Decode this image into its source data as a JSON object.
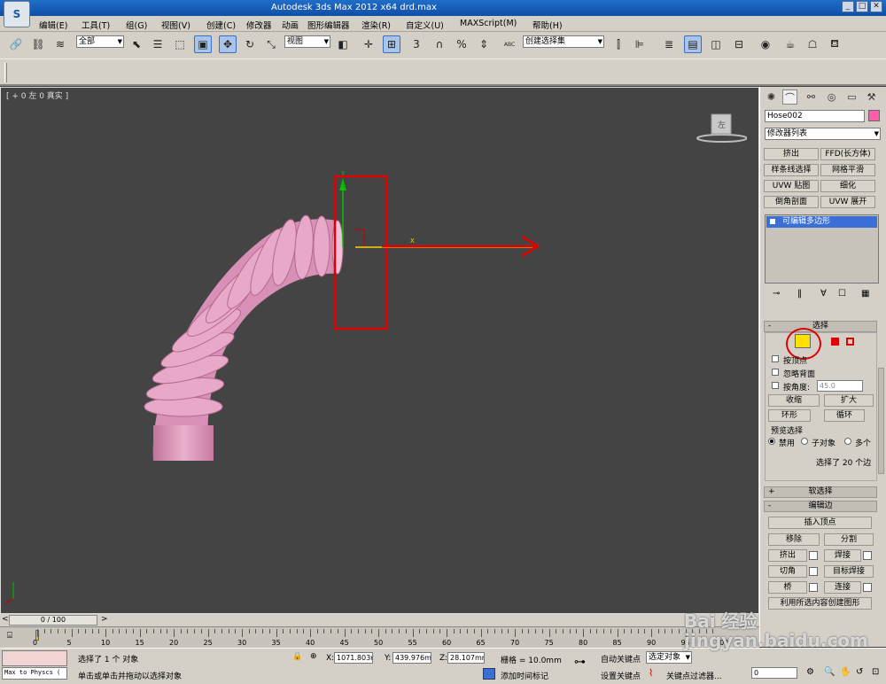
{
  "window": {
    "title": "Autodesk 3ds Max  2012 x64     drd.max",
    "logo": "S"
  },
  "menu": [
    "编辑(E)",
    "工具(T)",
    "组(G)",
    "视图(V)",
    "创建(C)",
    "修改器",
    "动画",
    "图形编辑器",
    "渲染(R)",
    "自定义(U)",
    "MAXScript(M)",
    "帮助(H)"
  ],
  "toolbar": {
    "selection_filter": "全部",
    "ref_coord": "视图",
    "named_selection": "创建选择集",
    "snap_3": "3",
    "percent": "%",
    "abc": "ABC"
  },
  "viewport": {
    "label": "[ + 0 左 0 真实 ]",
    "viewcube_face": "左",
    "axis_y": "Y",
    "axis_x": "X",
    "background": "#444444",
    "object_color": "#e6a0c4"
  },
  "panel": {
    "object_name": "Hose002",
    "object_color": "#ff5cab",
    "modifier_list": "修改器列表",
    "modifier_buttons": [
      "挤出",
      "FFD(长方体)",
      "样条线选择",
      "网格平滑",
      "UVW 贴图",
      "细化",
      "倒角剖面",
      "UVW 展开"
    ],
    "stack_item": "可编辑多边形",
    "selection": {
      "header": "选择",
      "by_vertex": "按顶点",
      "ignore_backfacing": "忽略背面",
      "by_angle": "按角度:",
      "angle_value": "45.0",
      "shrink": "收缩",
      "grow": "扩大",
      "ring": "环形",
      "loop": "循环",
      "preview_label": "预览选择",
      "disabled": "禁用",
      "sub_object": "子对象",
      "multi": "多个",
      "status": "选择了 20 个边"
    },
    "soft_selection": "软选择",
    "edit_edges": {
      "header": "编辑边",
      "insert_vertex": "插入顶点",
      "remove": "移除",
      "split": "分割",
      "extrude": "挤出",
      "weld": "焊接",
      "chamfer": "切角",
      "target_weld": "目标焊接",
      "bridge": "桥",
      "connect": "连接",
      "create_shape": "利用所选内容创建图形"
    }
  },
  "time": {
    "slider": "0 / 100",
    "ticks": [
      "0",
      "5",
      "10",
      "15",
      "20",
      "25",
      "30",
      "35",
      "40",
      "45",
      "50",
      "55",
      "60",
      "65",
      "70",
      "75",
      "80",
      "85",
      "90",
      "95",
      "100"
    ]
  },
  "status": {
    "script_text": "Max to Physcs (",
    "selected": "选择了 1 个 对象",
    "prompt": "单击或单击并拖动以选择对象",
    "x_label": "X:",
    "x": "1071.803m",
    "y_label": "Y:",
    "y": "439.976mr",
    "z_label": "Z:",
    "z": "28.107mm",
    "grid": "栅格 = 10.0mm",
    "add_time_tag": "添加时间标记",
    "auto_key": "自动关键点",
    "selected_obj": "选定对象",
    "set_key": "设置关键点",
    "key_filters": "关键点过滤器...",
    "frame": "0"
  },
  "watermark": "Bai 经验\njingyan.baidu.com"
}
